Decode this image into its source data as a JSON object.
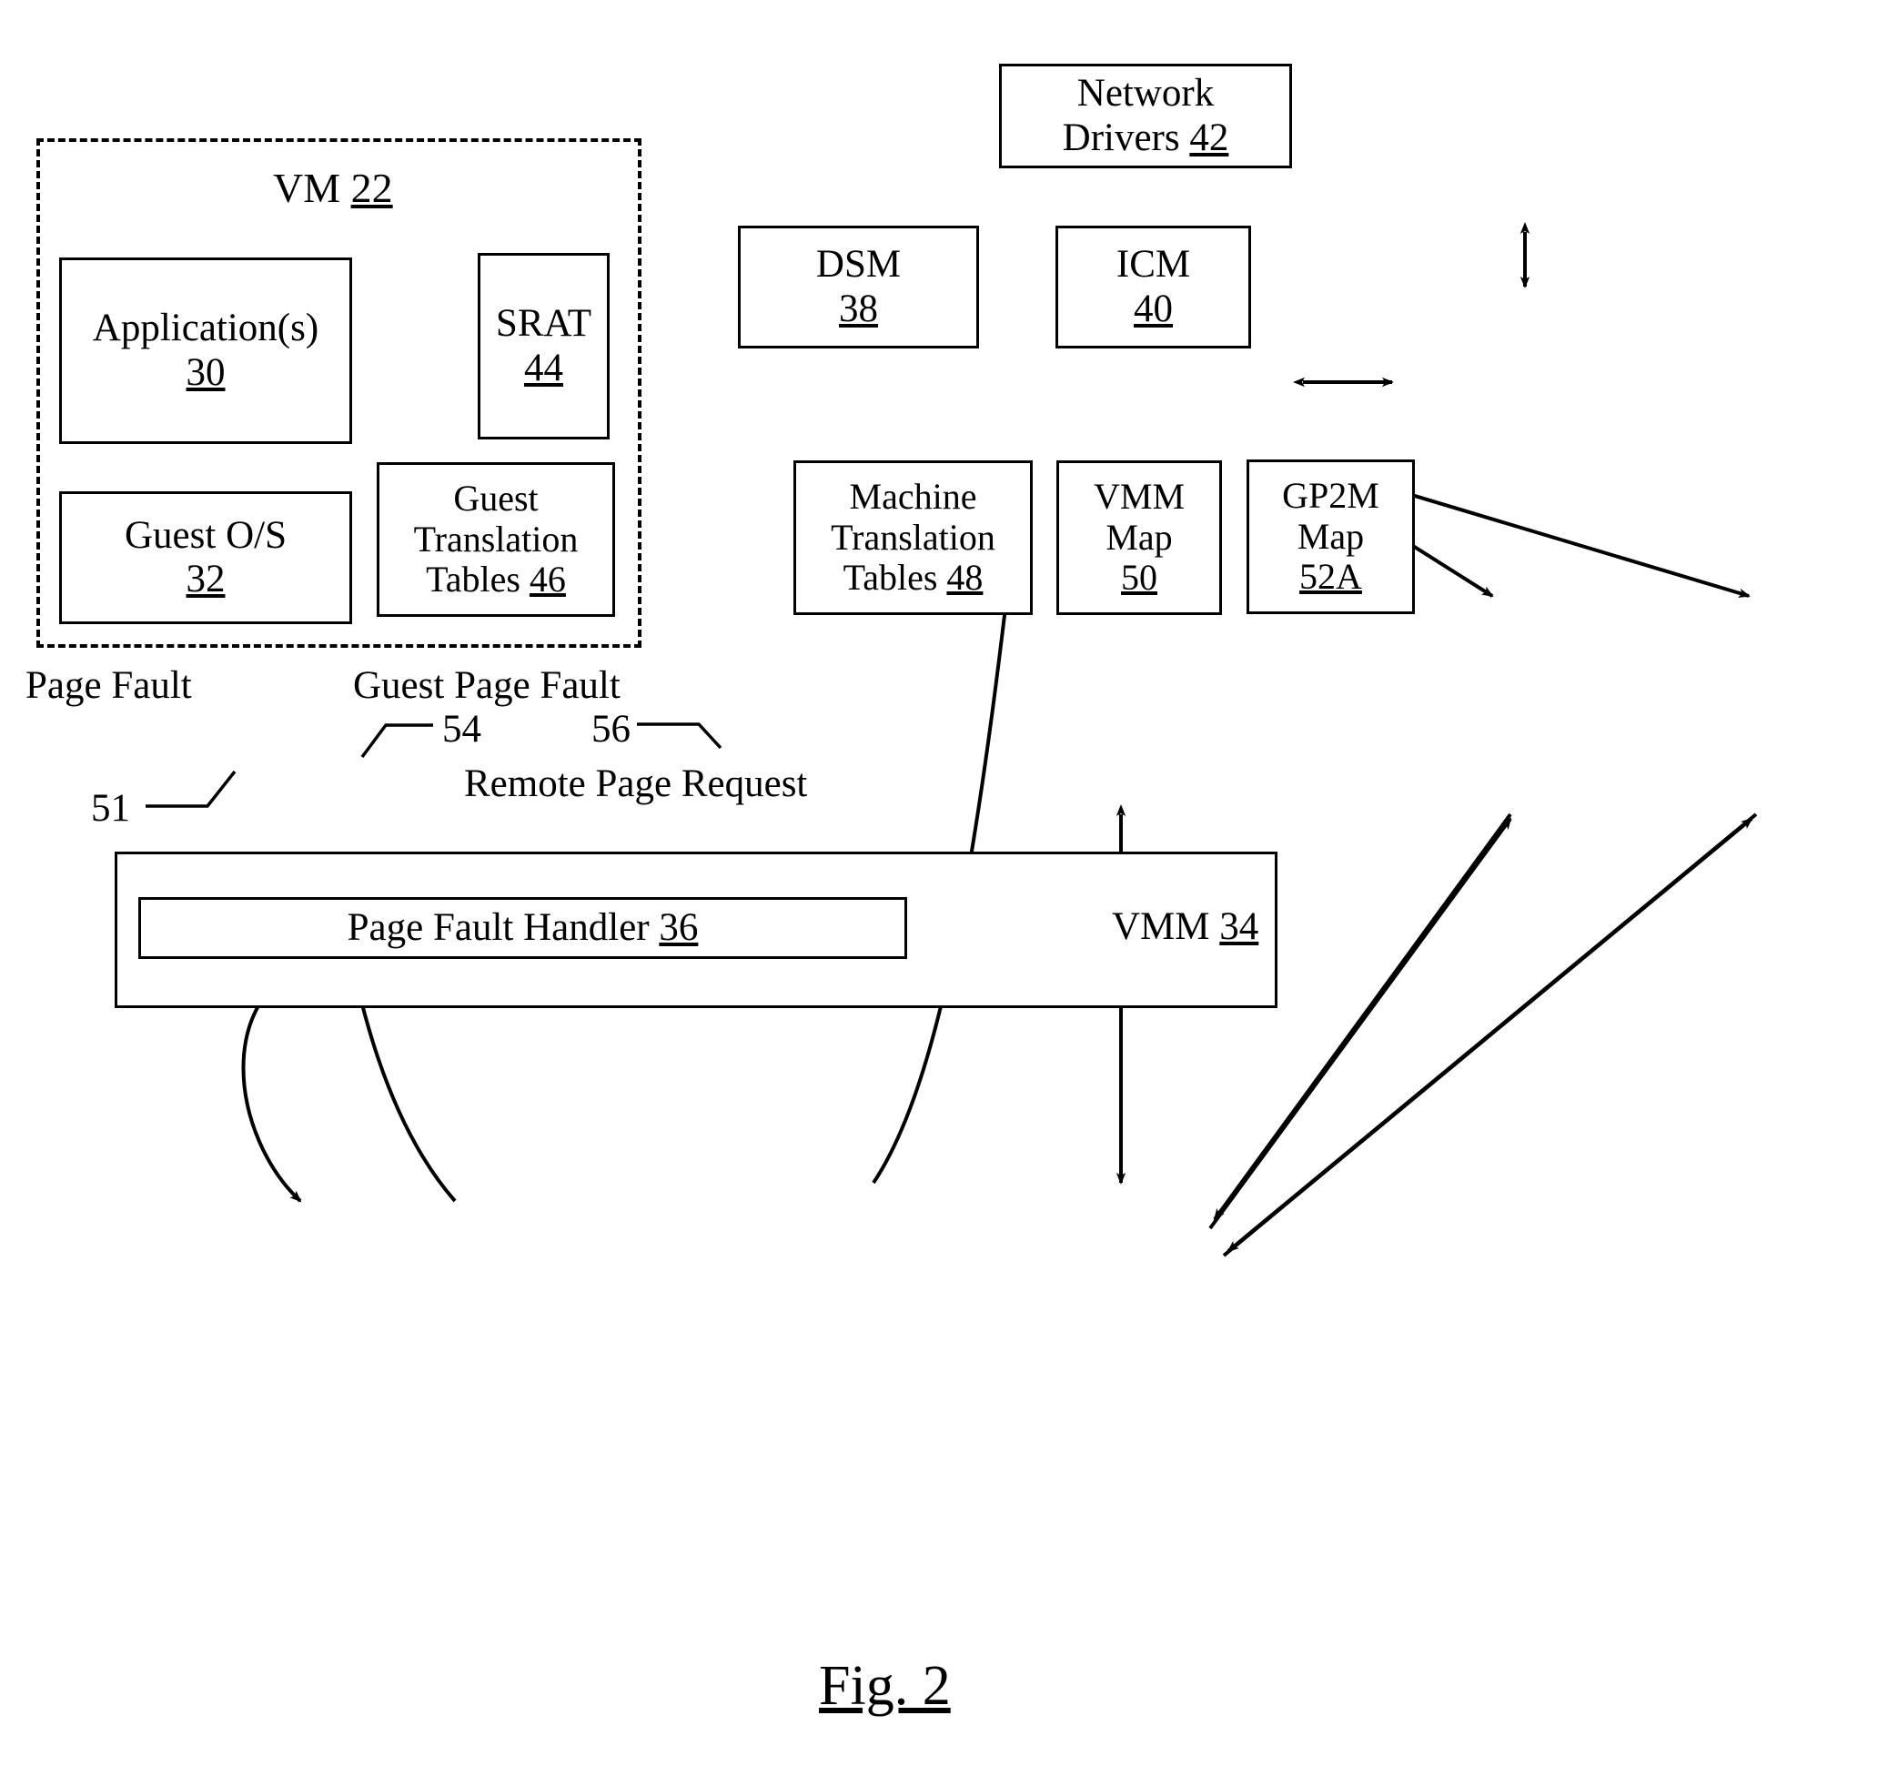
{
  "figure": {
    "caption": "Fig. 2",
    "type": "patent-block-diagram"
  },
  "vm_container": {
    "label_text": "VM ",
    "label_ref": "22"
  },
  "nodes": {
    "application": {
      "line1": "Application(s)",
      "ref": "30"
    },
    "srat": {
      "line1": "SRAT",
      "ref": "44"
    },
    "guest_os": {
      "line1": "Guest O/S",
      "ref": "32"
    },
    "guest_translation_tables": {
      "line1": "Guest",
      "line2": "Translation",
      "line3": "Tables ",
      "ref": "46"
    },
    "network_drivers": {
      "line1": "Network",
      "line2": "Drivers ",
      "ref": "42"
    },
    "dsm": {
      "line1": "DSM",
      "ref": "38"
    },
    "icm": {
      "line1": "ICM",
      "ref": "40"
    },
    "machine_translation_tables": {
      "line1": "Machine",
      "line2": "Translation",
      "line3": "Tables ",
      "ref": "48"
    },
    "vmm_map": {
      "line1": "VMM",
      "line2": "Map",
      "ref": "50"
    },
    "gp2m_map": {
      "line1": "GP2M",
      "line2": "Map",
      "ref": "52A"
    },
    "vmm": {
      "line1": "VMM ",
      "ref": "34"
    },
    "page_fault_handler": {
      "line1": "Page Fault Handler ",
      "ref": "36"
    }
  },
  "annotations": {
    "page_fault": "Page Fault",
    "guest_page_fault": "Guest Page Fault",
    "remote_page_request_line1": "Remote Page",
    "remote_page_request_line2": "Request",
    "ref_51": "51",
    "ref_54": "54",
    "ref_56": "56"
  },
  "style": {
    "line_color": "#000000",
    "background": "#ffffff"
  }
}
